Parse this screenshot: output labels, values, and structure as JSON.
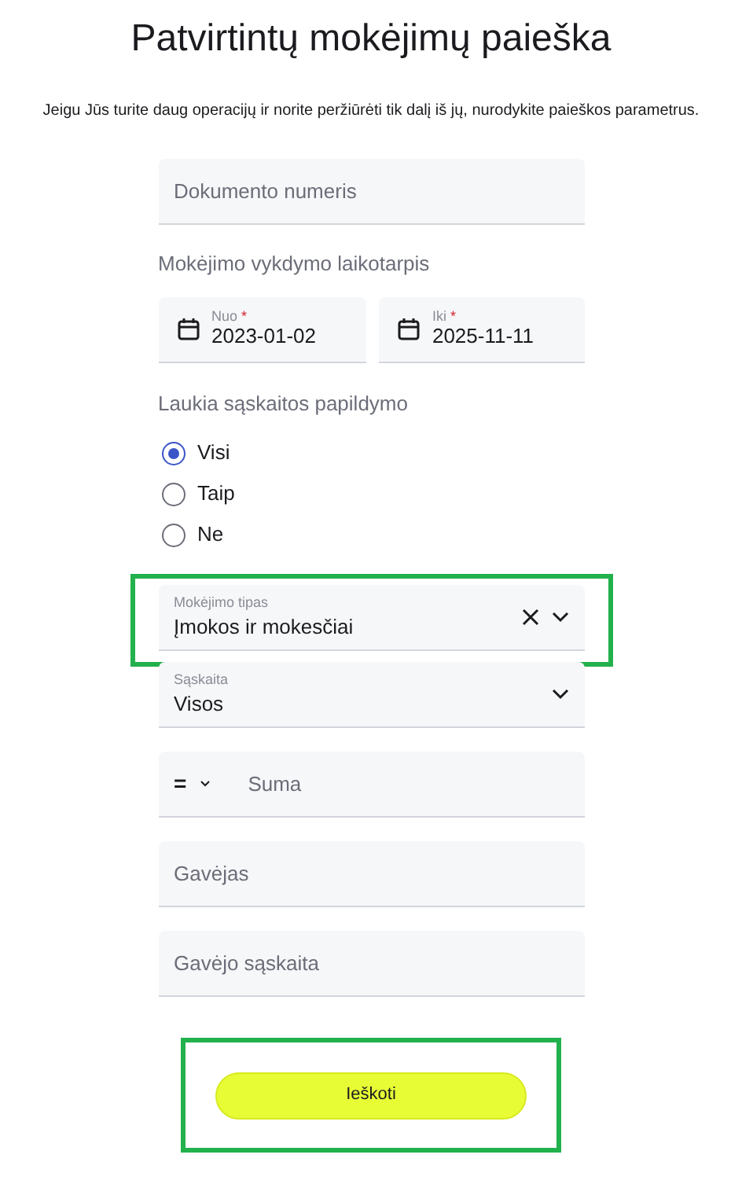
{
  "title": "Patvirtintų mokėjimų paieška",
  "intro": "Jeigu Jūs turite daug operacijų ir norite peržiūrėti tik dalį iš jų, nurodykite paieškos parametrus.",
  "document_number": {
    "placeholder": "Dokumento numeris"
  },
  "period": {
    "label": "Mokėjimo vykdymo laikotarpis",
    "from": {
      "label": "Nuo",
      "required_mark": "*",
      "value": "2023-01-02"
    },
    "to": {
      "label": "Iki",
      "required_mark": "*",
      "value": "2025-11-11"
    }
  },
  "top_up": {
    "label": "Laukia sąskaitos papildymo",
    "options": [
      {
        "label": "Visi",
        "selected": true
      },
      {
        "label": "Taip",
        "selected": false
      },
      {
        "label": "Ne",
        "selected": false
      }
    ]
  },
  "payment_type": {
    "label": "Mokėjimo tipas",
    "value": "Įmokos ir mokesčiai",
    "clearable": true,
    "highlighted": true
  },
  "account": {
    "label": "Sąskaita",
    "value": "Visos",
    "clearable": false,
    "highlighted": false
  },
  "amount": {
    "operator": "=",
    "placeholder": "Suma"
  },
  "payee": {
    "placeholder": "Gavėjas"
  },
  "payee_account": {
    "placeholder": "Gavėjo sąskaita"
  },
  "search_button": {
    "label": "Ieškoti",
    "highlighted": true
  }
}
